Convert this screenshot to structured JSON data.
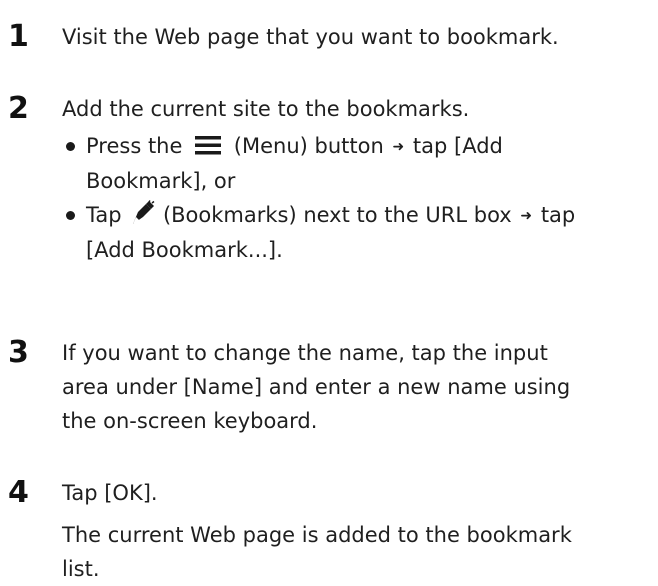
{
  "steps": [
    {
      "number": "1",
      "text": "Visit the Web page that you want to bookmark."
    },
    {
      "number": "2",
      "text": "Add the current site to the bookmarks.",
      "bullets": [
        {
          "part1": "Press the",
          "icon_name": "menu-icon",
          "part2": "(Menu) button",
          "arrow": "➜",
          "part3": "tap [Add",
          "cont": "Bookmark], or"
        },
        {
          "part1": "Tap",
          "icon_name": "bookmarks-icon",
          "part2": "(Bookmarks) next to the URL box",
          "arrow": "➜",
          "part3": "tap",
          "cont": "[Add Bookmark...]."
        }
      ]
    },
    {
      "number": "3",
      "lines": [
        "If you want to change the name, tap the input",
        "area under [Name] and enter a new name using",
        "the on-screen keyboard."
      ]
    },
    {
      "number": "4",
      "text": "Tap [OK].",
      "lines": [
        "The current Web page is added to the bookmark",
        "list."
      ]
    }
  ],
  "colors": {
    "text": "#1f1f1f",
    "number": "#111111"
  }
}
